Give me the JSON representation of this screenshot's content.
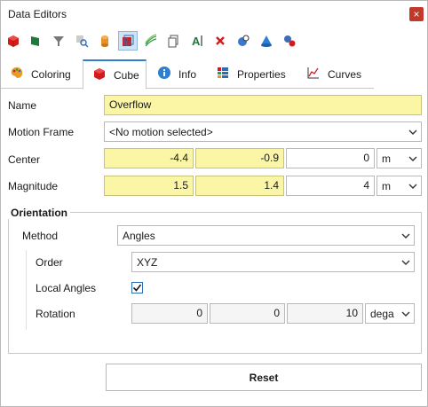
{
  "window": {
    "title": "Data Editors",
    "close_glyph": "×"
  },
  "toolbar": {
    "icons": [
      "red-cube-icon",
      "green-flag-icon",
      "filter-icon",
      "search-zoom-icon",
      "cylinder-icon",
      "cube-grid-icon",
      "lines-icon",
      "copy-icon",
      "text-format-icon",
      "delete-icon",
      "camera-point-icon",
      "cone-icon",
      "molecule-icon"
    ],
    "active_index": 5
  },
  "tabs": [
    {
      "label": "Coloring",
      "icon": "palette-icon"
    },
    {
      "label": "Cube",
      "icon": "red-cube-icon",
      "active": true
    },
    {
      "label": "Info",
      "icon": "info-icon"
    },
    {
      "label": "Properties",
      "icon": "properties-icon"
    },
    {
      "label": "Curves",
      "icon": "chart-curve-icon"
    }
  ],
  "form": {
    "name_label": "Name",
    "name_value": "Overflow",
    "motion_label": "Motion Frame",
    "motion_value": "<No motion selected>",
    "center_label": "Center",
    "center_x": "-4.4",
    "center_y": "-0.9",
    "center_z": "0",
    "center_unit": "m",
    "magnitude_label": "Magnitude",
    "mag_x": "1.5",
    "mag_y": "1.4",
    "mag_z": "4",
    "mag_unit": "m"
  },
  "orientation": {
    "title": "Orientation",
    "method_label": "Method",
    "method_value": "Angles",
    "order_label": "Order",
    "order_value": "XYZ",
    "local_label": "Local Angles",
    "local_checked": true,
    "rotation_label": "Rotation",
    "rot_x": "0",
    "rot_y": "0",
    "rot_z": "10",
    "rot_unit": "dega"
  },
  "reset_label": "Reset"
}
